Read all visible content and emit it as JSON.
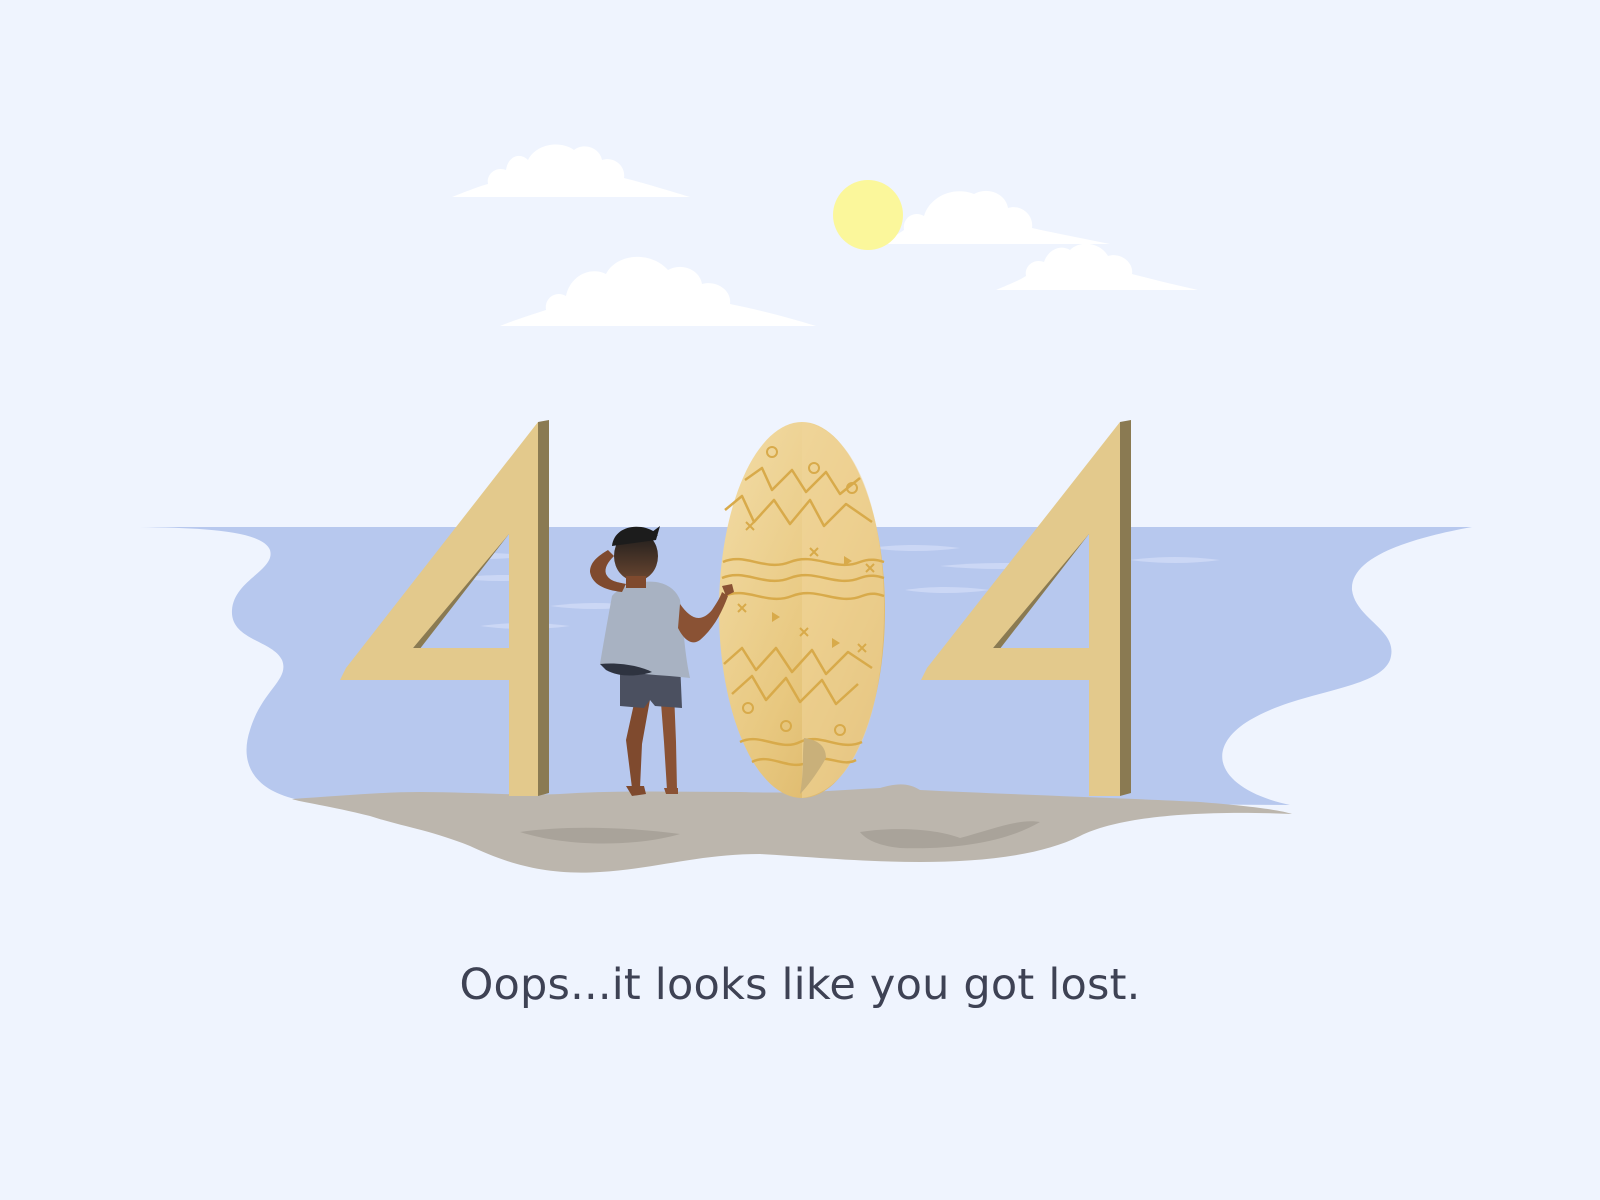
{
  "error": {
    "code": "404",
    "message": "Oops...it looks like you got lost."
  },
  "illustration": {
    "scene": "beach",
    "icons": [
      "sun-icon",
      "cloud-icon",
      "surfer-figure",
      "surfboard-icon"
    ],
    "colors": {
      "background": "#eff4fe",
      "sea": "#b7c8ee",
      "sea_light": "#cbd7f5",
      "sand": "#bcb6ad",
      "digit_face": "#e3c98c",
      "digit_side": "#8a7a52",
      "sun": "#fbf79b",
      "cloud": "#ffffff",
      "board": "#ecd193",
      "board_pattern": "#d8aa4a",
      "text": "#3e4254"
    }
  }
}
